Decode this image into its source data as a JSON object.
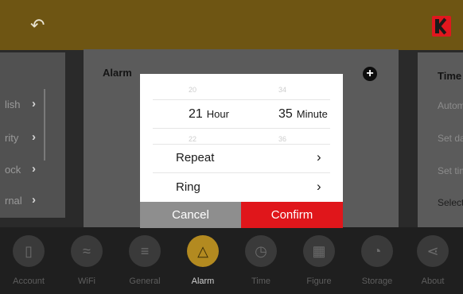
{
  "header": {
    "back_icon": "back-arrow-icon",
    "logo": "kodak-logo"
  },
  "left_panel": {
    "items": [
      {
        "label": "lish"
      },
      {
        "label": "rity"
      },
      {
        "label": "ock"
      },
      {
        "label": "rnal"
      }
    ]
  },
  "alarm_panel": {
    "title": "Alarm",
    "add_icon": "plus-circle-icon"
  },
  "right_panel": {
    "title": "Time",
    "items": [
      "Autom",
      "Set da",
      "Set tim",
      "Select"
    ]
  },
  "picker": {
    "hour_prev": "20",
    "hour_selected": "21",
    "hour_unit": "Hour",
    "hour_next": "22",
    "minute_prev": "34",
    "minute_selected": "35",
    "minute_unit": "Minute",
    "minute_next": "36"
  },
  "options": [
    {
      "label": "Repeat"
    },
    {
      "label": "Ring"
    }
  ],
  "buttons": {
    "cancel": "Cancel",
    "confirm": "Confirm"
  },
  "bottom_nav": [
    {
      "label": "Account",
      "icon": "phone-icon"
    },
    {
      "label": "WiFi",
      "icon": "wifi-icon"
    },
    {
      "label": "General",
      "icon": "list-icon"
    },
    {
      "label": "Alarm",
      "icon": "bell-icon",
      "active": true
    },
    {
      "label": "Time",
      "icon": "clock-icon"
    },
    {
      "label": "Figure",
      "icon": "image-icon"
    },
    {
      "label": "Storage",
      "icon": "pie-icon"
    },
    {
      "label": "About",
      "icon": "share-icon"
    }
  ],
  "colors": {
    "header": "#6e5513",
    "accent_active": "#b38a20",
    "confirm": "#e0161b",
    "cancel": "#8e8e8e"
  }
}
